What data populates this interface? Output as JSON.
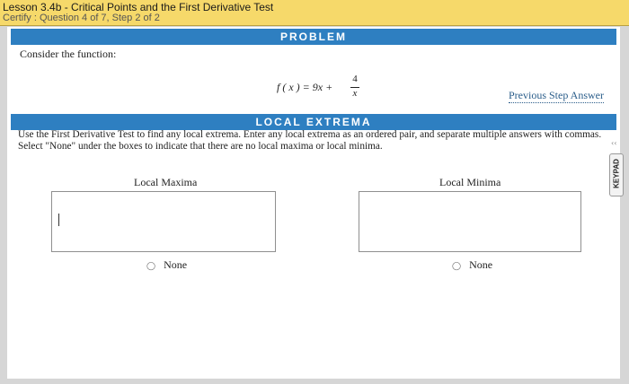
{
  "header": {
    "title": "Lesson 3.4b - Critical Points and the First Derivative Test",
    "subtitle": "Certify : Question 4 of 7, Step 2 of 2"
  },
  "problem": {
    "band_label": "PROBLEM",
    "intro": "Consider the function:",
    "formula_lhs": "f ( x ) = 9x +",
    "formula_num": "4",
    "formula_den": "x",
    "previous_step_label": "Previous Step Answer"
  },
  "local_extrema": {
    "band_label": "LOCAL EXTREMA",
    "instructions": "Use the First Derivative Test to find any local extrema. Enter any local extrema as an ordered pair, and separate multiple answers with commas. Select \"None\" under the boxes to indicate that there are no local maxima or local minima.",
    "maxima_label": "Local Maxima",
    "minima_label": "Local Minima",
    "maxima_value": "",
    "minima_value": "",
    "none_label": "None",
    "none_max_selected": false,
    "none_min_selected": false
  },
  "keypad": {
    "label": "KEYPAD",
    "icon": "arrow-icon"
  },
  "colors": {
    "title_bar": "#f6d96a",
    "band": "#2e7fc1",
    "link": "#2a5d8a",
    "page_bg": "#d6d6d6"
  }
}
